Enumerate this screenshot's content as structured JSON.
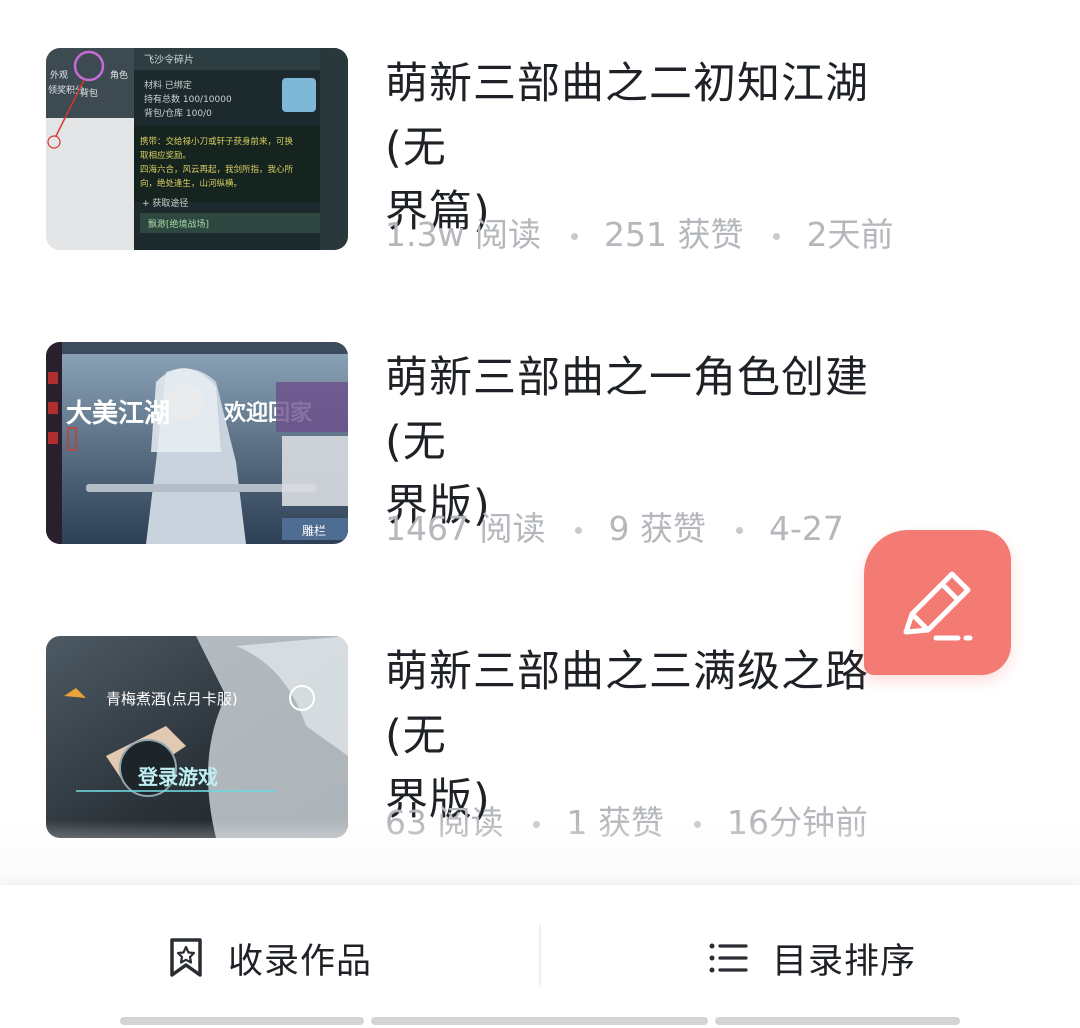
{
  "articles": [
    {
      "title": "萌新三部曲之二初知江湖 (无界篇)",
      "title_line1": "萌新三部曲之二初知江湖 (无",
      "title_line2": "界篇)",
      "reads": "1.3w 阅读",
      "likes": "251 获赞",
      "time": "2天前",
      "thumb_texts": {
        "header": "飞沙令碎片",
        "row1": "材料 已绑定",
        "row2": "持有总数 100/10000",
        "row3": "背包/仓库 100/0",
        "desc1": "携带：交给禄小刀或轩子获身前来，可换",
        "desc2": "取相应奖励。",
        "desc3": "四海六合，风云再起，我剑所指，我心所",
        "desc4": "向，绝处逢生，山河纵横。",
        "source": "+ 获取途径",
        "source_item": "飘渺[绝境战场]",
        "side1": "背包",
        "side2": "角色",
        "side3": "外观",
        "side4": "领奖积分"
      }
    },
    {
      "title": "萌新三部曲之一角色创建 (无界版)",
      "title_line1": "萌新三部曲之一角色创建 (无",
      "title_line2": "界版)",
      "reads": "1467 阅读",
      "likes": "9 获赞",
      "time": "4-27",
      "thumb_texts": {
        "banner_left": "大美江湖",
        "banner_right": "欢迎回家",
        "button": "雕栏"
      }
    },
    {
      "title": "萌新三部曲之三满级之路 (无界版)",
      "title_line1": "萌新三部曲之三满级之路 (无",
      "title_line2": "界版)",
      "reads": "63 阅读",
      "likes": "1 获赞",
      "time": "16分钟前",
      "thumb_texts": {
        "server": "青梅煮酒(点月卡服)",
        "login": "登录游戏"
      }
    }
  ],
  "fab": {
    "icon": "pen-icon"
  },
  "bottom_bar": {
    "collect_label": "收录作品",
    "collect_icon": "bookmark-icon",
    "sort_label": "目录排序",
    "sort_icon": "list-icon"
  },
  "colors": {
    "fab": "#f47a74",
    "title": "#1e2125",
    "meta": "#b4b7bb"
  }
}
